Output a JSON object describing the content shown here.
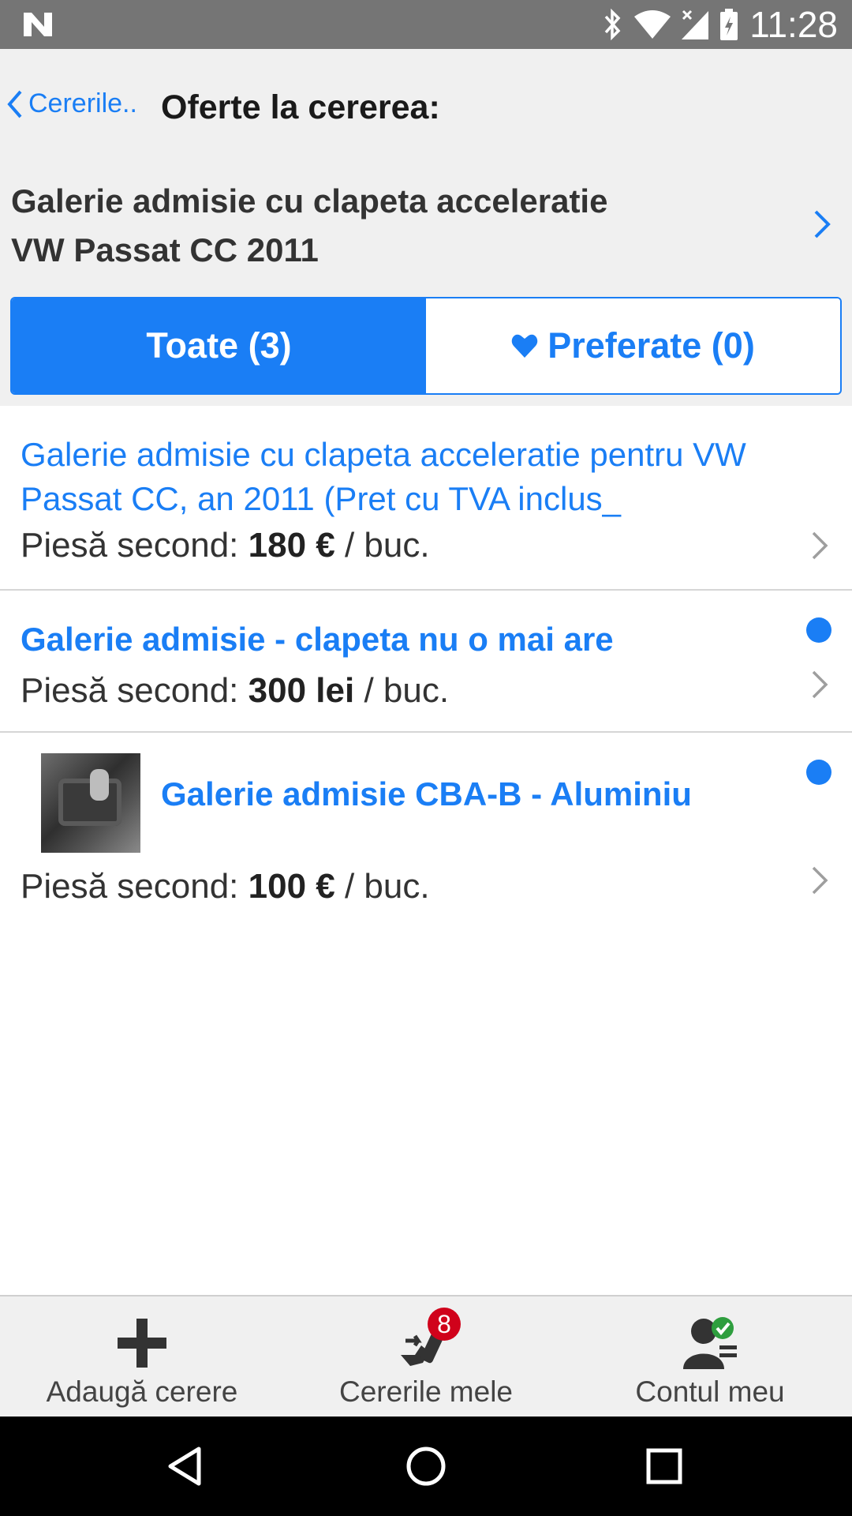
{
  "status_bar": {
    "time": "11:28"
  },
  "header": {
    "back_label": "Cererile..",
    "title": "Oferte la cererea:",
    "request_title_line1": "Galerie admisie cu clapeta acceleratie",
    "request_title_line2": "VW Passat CC 2011"
  },
  "tabs": {
    "all_label": "Toate (3)",
    "favorites_label": "Preferate (0)"
  },
  "offers": [
    {
      "title": "Galerie admisie cu clapeta acceleratie pentru VW Passat CC, an 2011 (Pret cu TVA inclus_",
      "price_prefix": "Piesă second:",
      "price": "180 €",
      "unit": "/ buc.",
      "is_new": false,
      "has_image": false
    },
    {
      "title": "Galerie admisie - clapeta nu o mai are",
      "price_prefix": "Piesă second:",
      "price": "300 lei",
      "unit": "/ buc.",
      "is_new": true,
      "has_image": false
    },
    {
      "title": "Galerie admisie CBA-B - Aluminiu",
      "price_prefix": "Piesă second:",
      "price": "100 €",
      "unit": "/ buc.",
      "is_new": true,
      "has_image": true
    }
  ],
  "bottom_nav": {
    "add_label": "Adaugă cerere",
    "requests_label": "Cererile mele",
    "requests_badge": "8",
    "account_label": "Contul meu"
  },
  "colors": {
    "accent": "#1a7ef5",
    "badge": "#d0021b",
    "status_bar": "#757575"
  }
}
